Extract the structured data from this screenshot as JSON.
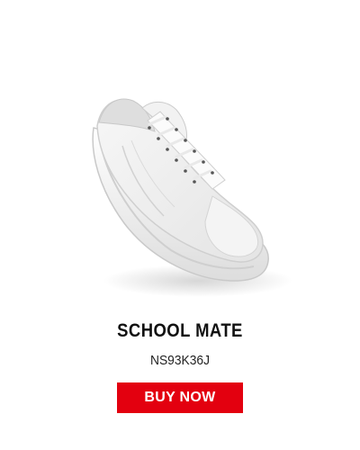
{
  "product": {
    "name": "SCHOOL MATE",
    "code": "NS93K36J",
    "image_icon": "white-canvas-sneaker-image"
  },
  "actions": {
    "buy_label": "BUY NOW"
  },
  "colors": {
    "button_background": "#e3000f",
    "button_text": "#ffffff",
    "title_text": "#111111"
  }
}
